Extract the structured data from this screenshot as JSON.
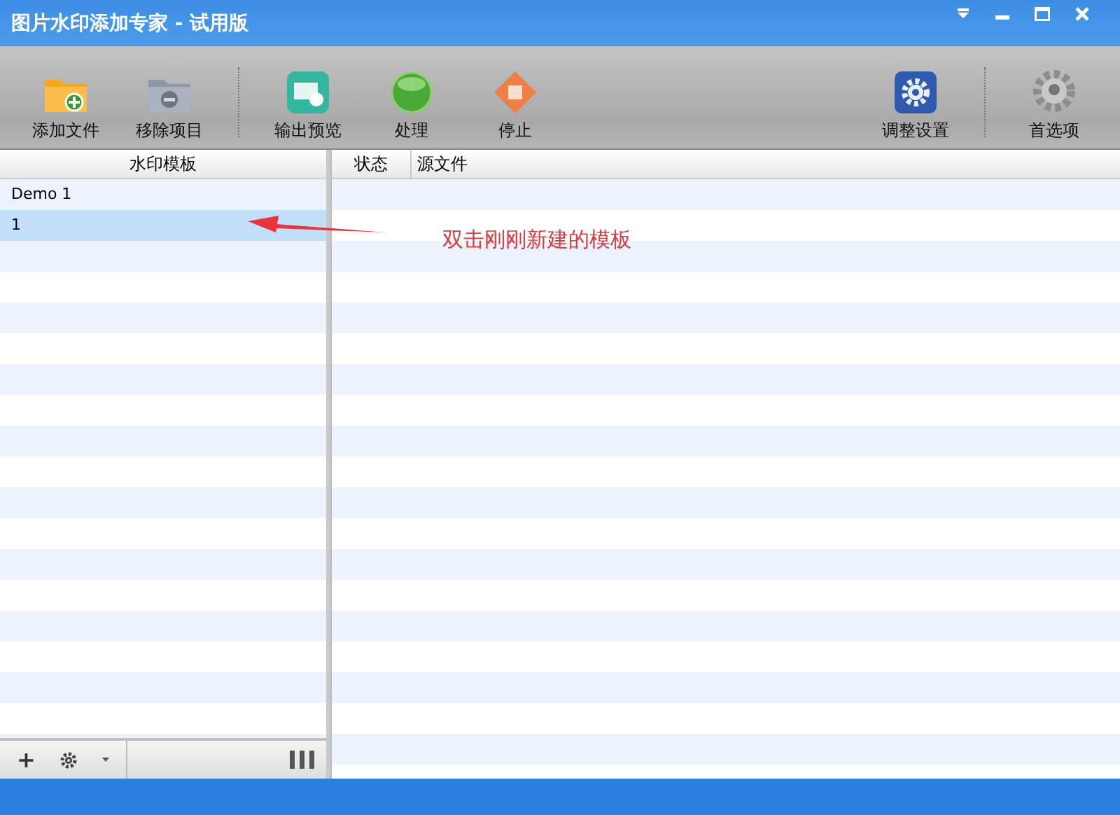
{
  "window": {
    "title": "图片水印添加专家 - 试用版"
  },
  "toolbar": {
    "left": [
      {
        "label": "添加文件",
        "kind": "add-folder"
      },
      {
        "label": "移除项目",
        "kind": "remove-folder"
      },
      {
        "kind": "separator"
      },
      {
        "label": "输出预览",
        "kind": "preview"
      },
      {
        "label": "处理",
        "kind": "start"
      },
      {
        "label": "停止",
        "kind": "stop"
      }
    ],
    "right": [
      {
        "label": "调整设置",
        "kind": "gear"
      },
      {
        "kind": "separator"
      },
      {
        "label": "首选项",
        "kind": "preferences"
      }
    ]
  },
  "template_panel": {
    "header": "水印模板",
    "items": [
      {
        "label": "Demo 1",
        "selected": false
      },
      {
        "label": "1",
        "selected": true
      }
    ],
    "bottom_bar": {
      "add": "+"
    }
  },
  "file_list": {
    "columns": [
      "状态",
      "源文件"
    ]
  },
  "annotation": {
    "text": "双击刚刚新建的模板"
  }
}
